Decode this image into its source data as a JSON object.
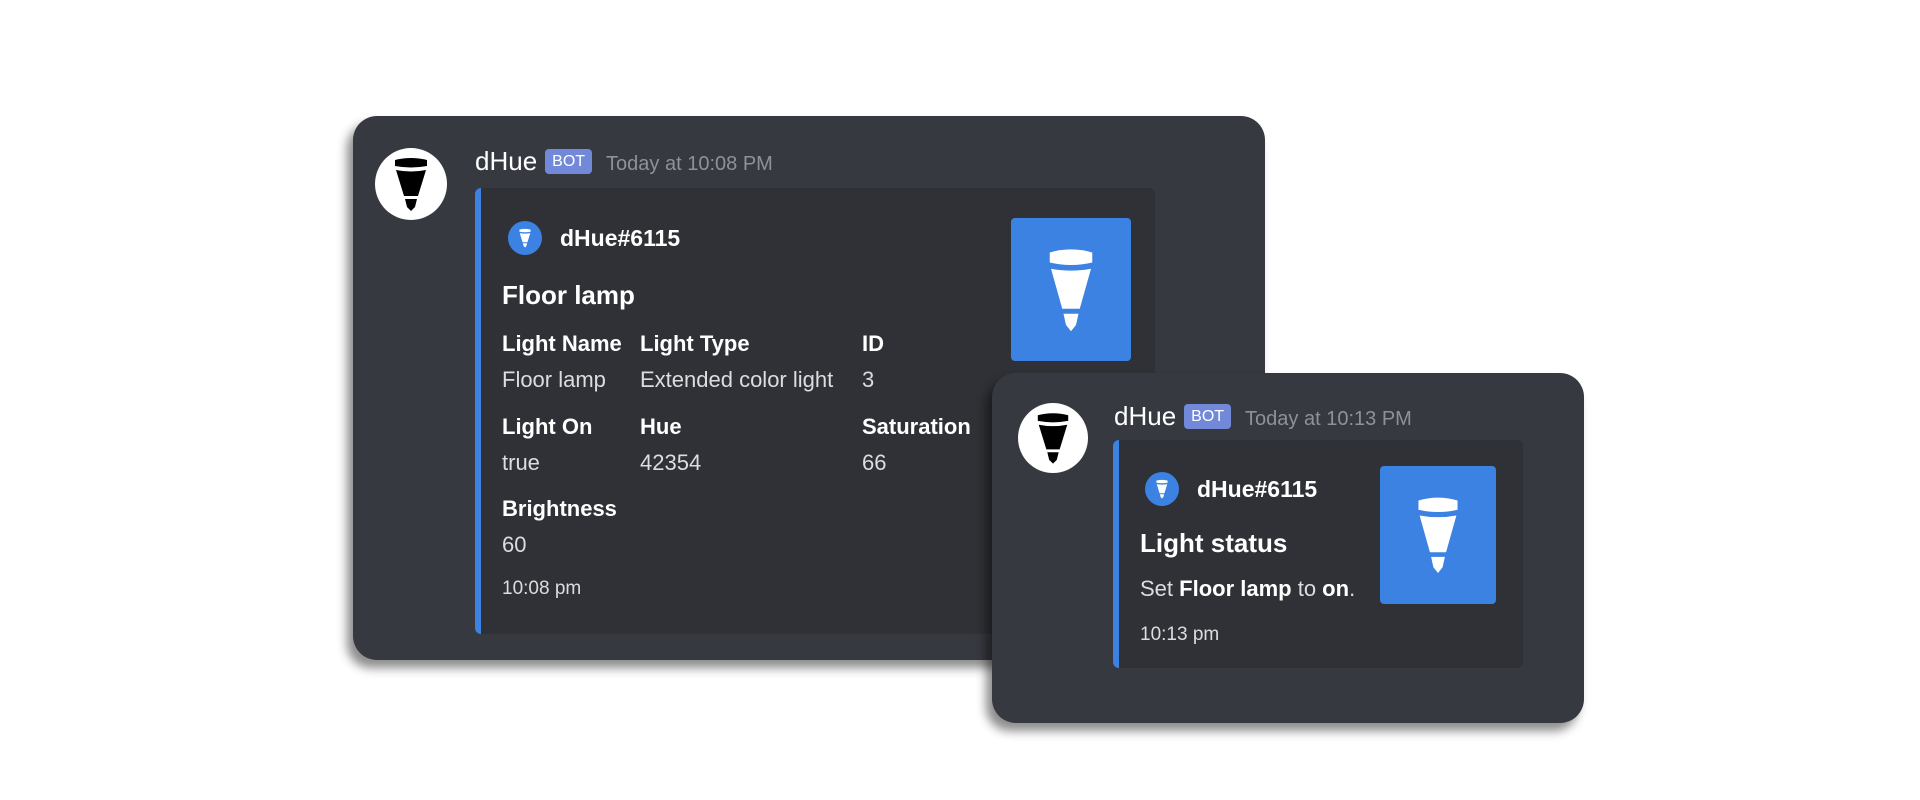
{
  "messages": [
    {
      "avatar_icon": "bulb-icon",
      "username": "dHue",
      "bot_tag": "BOT",
      "timestamp": "Today at 10:08 PM",
      "embed": {
        "accent_color": "#3b82e3",
        "author_icon": "bulb-icon",
        "author": "dHue#6115",
        "thumbnail_icon": "bulb-icon",
        "title": "Floor lamp",
        "fields": [
          {
            "name": "Light Name",
            "value": "Floor lamp"
          },
          {
            "name": "Light Type",
            "value": "Extended color light"
          },
          {
            "name": "ID",
            "value": "3"
          },
          {
            "name": "Light On",
            "value": "true"
          },
          {
            "name": "Hue",
            "value": "42354"
          },
          {
            "name": "Saturation",
            "value": "66"
          },
          {
            "name": "Brightness",
            "value": "60"
          }
        ],
        "footer": "10:08 pm"
      }
    },
    {
      "avatar_icon": "bulb-icon",
      "username": "dHue",
      "bot_tag": "BOT",
      "timestamp": "Today at 10:13 PM",
      "embed": {
        "accent_color": "#3b82e3",
        "author_icon": "bulb-icon",
        "author": "dHue#6115",
        "thumbnail_icon": "bulb-icon",
        "title": "Light status",
        "description": {
          "prefix": "Set ",
          "light": "Floor lamp",
          "middle": " to ",
          "state": "on",
          "suffix": "."
        },
        "footer": "10:13 pm"
      }
    }
  ],
  "colors": {
    "background": "#ffffff",
    "card": "#36393f",
    "embed": "#2f3136",
    "accent": "#3b82e3",
    "bot_tag": "#7289da",
    "timestamp": "#8e9297"
  }
}
